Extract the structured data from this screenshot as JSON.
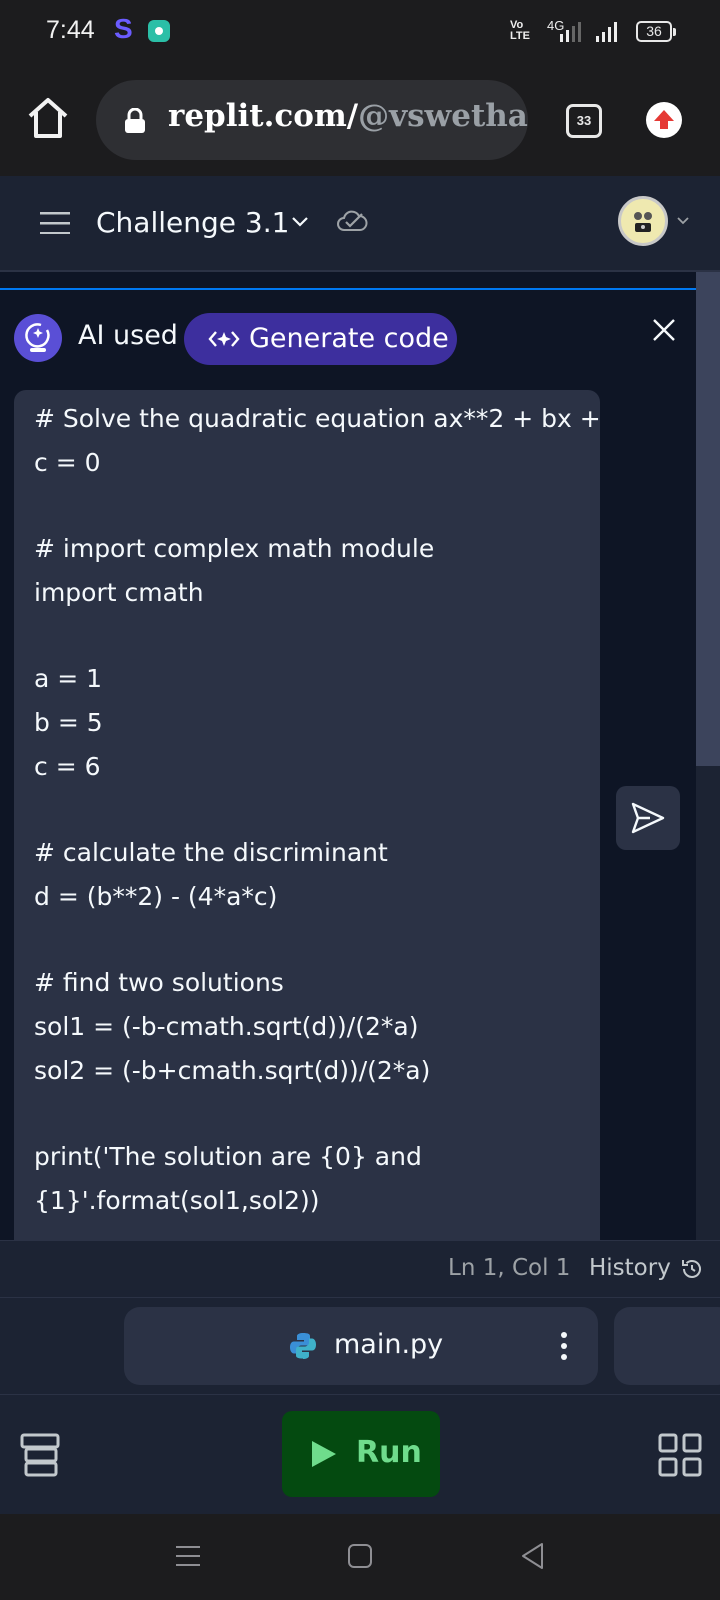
{
  "status_bar": {
    "time": "7:44",
    "app_letter": "S",
    "volte_line1": "Vo",
    "volte_line2": "LTE",
    "network": "4G",
    "battery": "36"
  },
  "browser": {
    "url_host": "replit.com/",
    "url_path": "@vswethacs",
    "tab_count": "33"
  },
  "app_header": {
    "repl_title": "Challenge 3.1"
  },
  "ai_panel": {
    "ai_used_label": "AI used",
    "generate_code_label": "Generate code"
  },
  "code": {
    "lines": [
      "# Solve the quadratic equation ax**2 + bx +",
      "c = 0",
      "",
      "# import complex math module",
      "import cmath",
      "",
      "a = 1",
      "b = 5",
      "c = 6",
      "",
      "# calculate the discriminant",
      "d = (b**2) - (4*a*c)",
      "",
      "# find two solutions",
      "sol1 = (-b-cmath.sqrt(d))/(2*a)",
      "sol2 = (-b+cmath.sqrt(d))/(2*a)",
      "",
      "print('The solution are {0} and",
      "{1}'.format(sol1,sol2))"
    ]
  },
  "status_line": {
    "cursor_position": "Ln 1, Col 1",
    "history_label": "History"
  },
  "file_tabs": {
    "active_file": "main.py"
  },
  "toolbar": {
    "run_label": "Run"
  },
  "colors": {
    "background": "#0e1525",
    "surface": "#1c2333",
    "card": "#2b3245",
    "accent_purple": "#3d2f9e",
    "run_green": "#6fdc8c",
    "run_bg": "#044a10",
    "focus_blue": "#0079f2"
  },
  "icons": {
    "home": "home-icon",
    "lock": "lock-icon",
    "tabs": "tabs-icon",
    "upload": "upload-icon",
    "menu": "menu-icon",
    "chevron": "chevron-down-icon",
    "cloud": "cloud-check-icon",
    "ai": "ai-assistant-icon",
    "generate": "code-sparkle-icon",
    "close": "close-icon",
    "send": "send-icon",
    "history": "history-icon",
    "python": "python-icon",
    "more": "more-vertical-icon",
    "database": "database-icon",
    "play": "play-icon",
    "grid": "grid-icon"
  }
}
